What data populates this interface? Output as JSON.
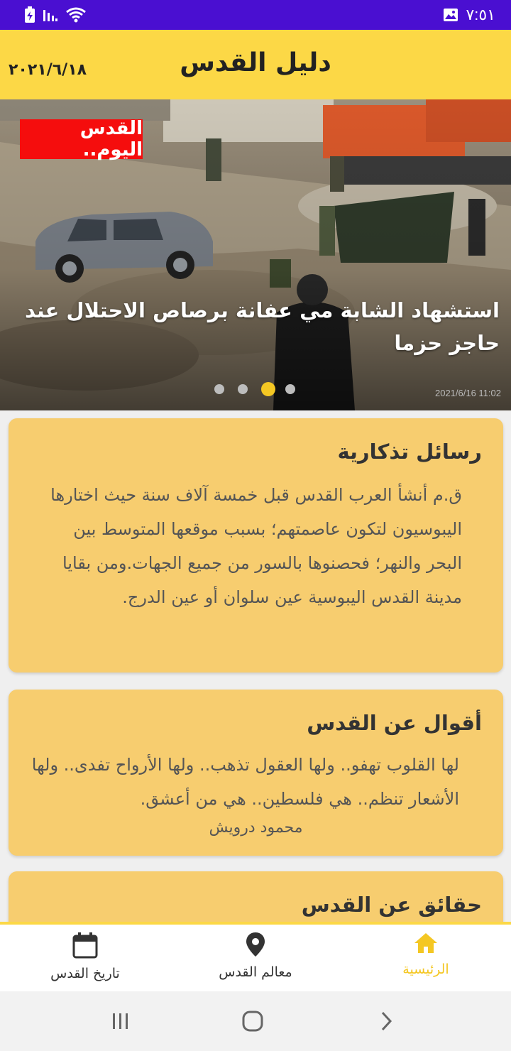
{
  "status_bar": {
    "time": "٧:٥١",
    "icons": [
      "battery-charging-icon",
      "signal-icon",
      "wifi-icon",
      "image-icon"
    ]
  },
  "app_bar": {
    "title": "دليل القدس",
    "date": "٢٠٢١/٦/١٨",
    "background": "#fcd846"
  },
  "hero": {
    "badge": "القدس اليوم..",
    "headline": "استشهاد الشابة مي عفانة برصاص الاحتلال عند حاجز حزما",
    "timestamp": "2021/6/16  11:02",
    "slide_count": 4,
    "active_slide": 3,
    "badge_color": "#f50d0d"
  },
  "cards": [
    {
      "title": "رسائل تذكارية",
      "body": "ق.م أنشأ العرب القدس قبل خمسة آلاف سنة  حيث اختارها اليبوسيون لتكون عاصمتهم؛ بسبب موقعها المتوسط بين البحر والنهر؛ فحصنوها بالسور من جميع الجهات.ومن بقايا مدينة القدس اليبوسية عين سلوان أو عين الدرج."
    },
    {
      "title": "أقوال عن القدس",
      "body": "لها القلوب تهفو.. ولها العقول تذهب.. ولها الأرواح تفدى.. ولها الأشعار تنظم.. هي فلسطين.. هي من أعشق.",
      "author": "محمود درويش"
    },
    {
      "title": "حقائق عن القدس"
    }
  ],
  "bottom_nav": {
    "items": [
      {
        "label": "الرئيسية",
        "icon": "home-icon",
        "active": true
      },
      {
        "label": "معالم القدس",
        "icon": "location-pin-icon",
        "active": false
      },
      {
        "label": "تاريخ القدس",
        "icon": "calendar-icon",
        "active": false
      }
    ],
    "accent": "#f4c723"
  },
  "system_nav": {
    "buttons": [
      "recent-apps-icon",
      "home-circle-icon",
      "back-icon"
    ]
  }
}
